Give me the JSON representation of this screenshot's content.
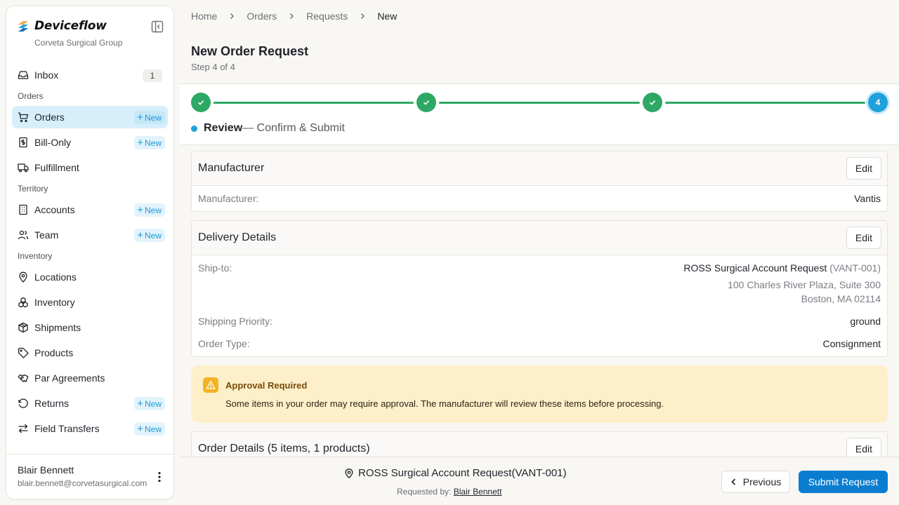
{
  "app": {
    "name": "Deviceflow",
    "org": "Corveta Surgical Group"
  },
  "sidebar": {
    "inbox": {
      "label": "Inbox",
      "count": "1"
    },
    "new_label": "New",
    "sections": {
      "orders": "Orders",
      "territory": "Territory",
      "inventory": "Inventory"
    },
    "items": {
      "orders": "Orders",
      "bill_only": "Bill-Only",
      "fulfillment": "Fulfillment",
      "accounts": "Accounts",
      "team": "Team",
      "locations": "Locations",
      "inventory": "Inventory",
      "shipments": "Shipments",
      "products": "Products",
      "par_agreements": "Par Agreements",
      "returns": "Returns",
      "field_transfers": "Field Transfers"
    },
    "user": {
      "name": "Blair Bennett",
      "email": "blair.bennett@corvetasurgical.com"
    }
  },
  "breadcrumb": [
    "Home",
    "Orders",
    "Requests",
    "New"
  ],
  "page": {
    "title": "New Order Request",
    "subtitle": "Step 4 of 4"
  },
  "stepper": {
    "current_step": "4",
    "current_title": "Review",
    "current_desc": "— Confirm & Submit"
  },
  "manufacturer_card": {
    "title": "Manufacturer",
    "edit": "Edit",
    "label": "Manufacturer:",
    "value": "Vantis"
  },
  "delivery_card": {
    "title": "Delivery Details",
    "edit": "Edit",
    "ship_to_label": "Ship-to:",
    "ship_to_name": "ROSS Surgical Account Request",
    "ship_to_code": "(VANT-001)",
    "address_line1": "100 Charles River Plaza, Suite 300",
    "address_line2": "Boston, MA 02114",
    "priority_label": "Shipping Priority:",
    "priority_value": "ground",
    "order_type_label": "Order Type:",
    "order_type_value": "Consignment"
  },
  "alert": {
    "title": "Approval Required",
    "text": "Some items in your order may require approval. The manufacturer will review these items before processing."
  },
  "order_details_card": {
    "title": "Order Details (5 items, 1 products)",
    "edit": "Edit"
  },
  "footer": {
    "account": "ROSS Surgical Account Request(VANT-001)",
    "requested_by_label": "Requested by:",
    "requested_by_name": "Blair Bennett",
    "previous": "Previous",
    "submit": "Submit Request"
  },
  "colors": {
    "accent": "#0b7dd0",
    "active_nav_bg": "#d6effa",
    "step_complete": "#2ea865",
    "step_current": "#1ea1dc",
    "alert_bg": "#fdefc9"
  }
}
